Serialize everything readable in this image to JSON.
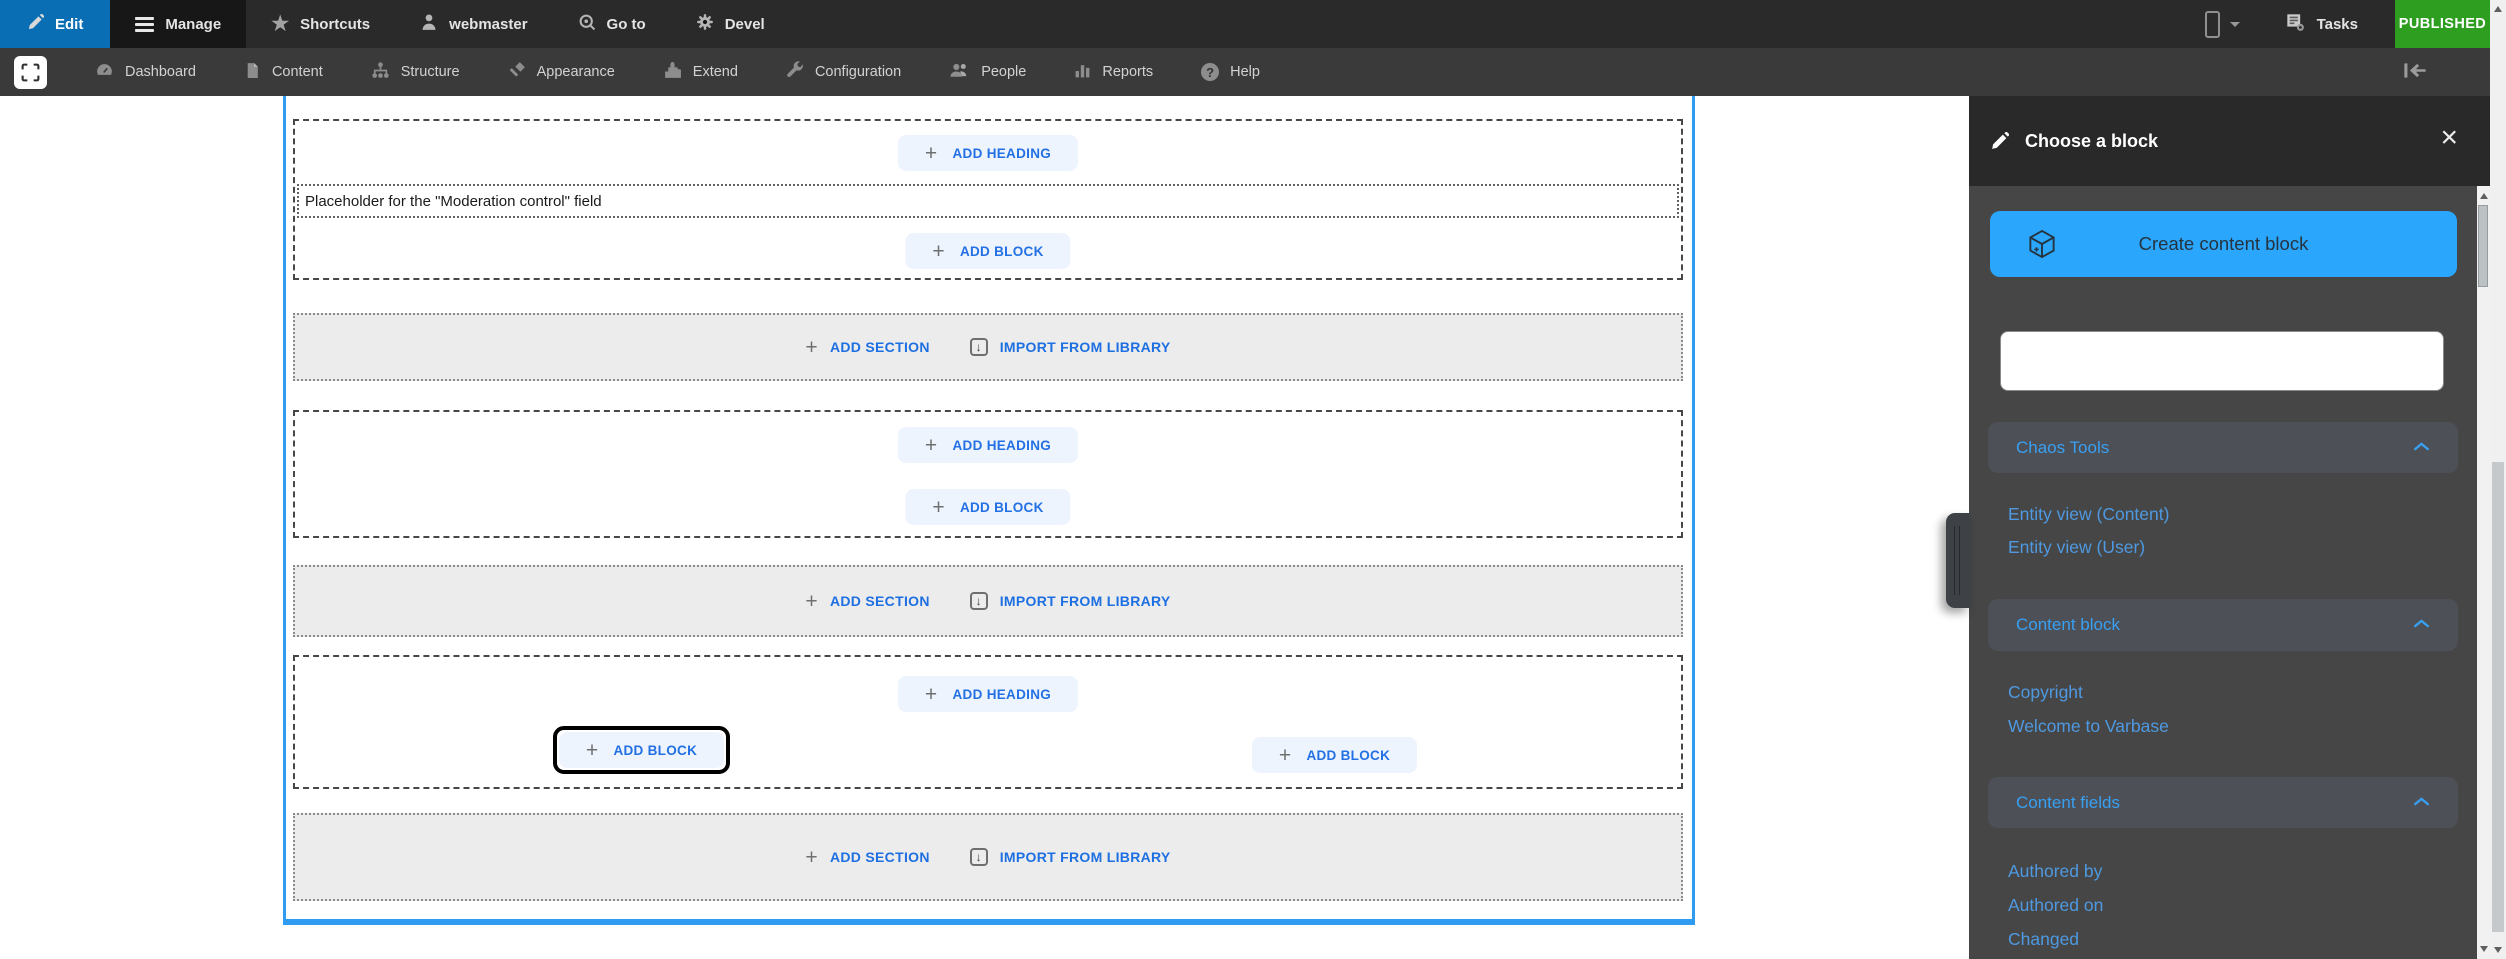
{
  "icons": {
    "star": "★",
    "close": "×",
    "down_arrow": "↓",
    "question": "?",
    "plus": "+"
  },
  "top_toolbar": {
    "edit": "Edit",
    "manage": "Manage",
    "shortcuts": "Shortcuts",
    "user": "webmaster",
    "go_to": "Go to",
    "devel": "Devel",
    "tasks": "Tasks",
    "status_badge": "PUBLISHED"
  },
  "admin_toolbar": {
    "items": [
      "Dashboard",
      "Content",
      "Structure",
      "Appearance",
      "Extend",
      "Configuration",
      "People",
      "Reports",
      "Help"
    ]
  },
  "layout_builder": {
    "add_heading": "ADD HEADING",
    "add_block": "ADD BLOCK",
    "add_section": "ADD SECTION",
    "import_from_library": "IMPORT FROM LIBRARY",
    "moderation_placeholder": "Placeholder for the \"Moderation control\" field"
  },
  "panel": {
    "title": "Choose a block",
    "create_content_block": "Create content block",
    "search": {
      "value": "",
      "placeholder": ""
    },
    "categories": [
      {
        "label": "Chaos Tools",
        "links": [
          "Entity view (Content)",
          "Entity view (User)"
        ]
      },
      {
        "label": "Content block",
        "links": [
          "Copyright",
          "Welcome to Varbase"
        ]
      },
      {
        "label": "Content fields",
        "links": [
          "Authored by",
          "Authored on",
          "Changed"
        ]
      }
    ]
  },
  "colors": {
    "accent_blue": "#2f9cf1",
    "action_blue": "#2270e4",
    "published_green": "#2e9e21",
    "create_button_blue": "#2ba6fd",
    "panel_link_blue": "#4e99e1"
  }
}
